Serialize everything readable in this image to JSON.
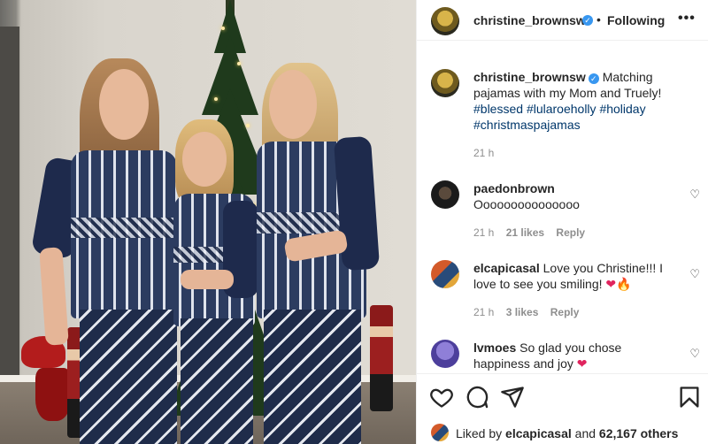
{
  "post": {
    "author": "christine_brownsw",
    "follow_status": "Following",
    "more_label": "•••",
    "dot": "•",
    "verified_icon": "verified-badge-icon",
    "caption": {
      "text": "Matching pajamas with my Mom and Truely!",
      "hashtags": [
        "#blessed",
        "#lularoeholly",
        "#holiday",
        "#christmaspajamas"
      ],
      "time": "21 h"
    }
  },
  "comments": [
    {
      "user": "paedonbrown",
      "text": "Ooooooooooooooo",
      "time": "21 h",
      "likes": "21 likes",
      "reply": "Reply"
    },
    {
      "user": "elcapicasal",
      "text": "Love you Christine!!! I love to see you smiling!",
      "emojis": [
        "❤",
        "🔥"
      ],
      "time": "21 h",
      "likes": "3 likes",
      "reply": "Reply"
    },
    {
      "user": "lvmoes",
      "text": "So glad you chose happiness and joy",
      "emojis": [
        "❤"
      ]
    }
  ],
  "likes": {
    "prefix": "Liked by",
    "user": "elcapicasal",
    "conjunction": "and",
    "others": "62,167 others"
  },
  "icons": {
    "like": "heart-icon",
    "comment": "comment-icon",
    "share": "share-icon",
    "save": "bookmark-icon",
    "comment_like": "heart-outline-icon"
  },
  "colors": {
    "hashtag": "#00376b",
    "verified": "#3897f0",
    "meta_text": "#8e8e8e"
  }
}
